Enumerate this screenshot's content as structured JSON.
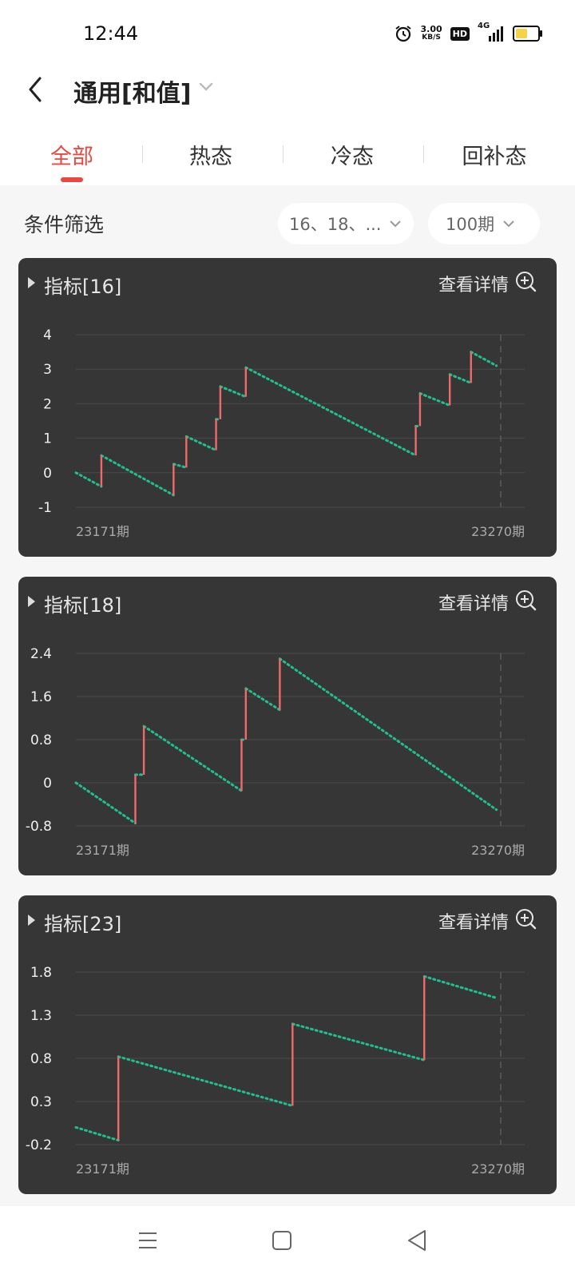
{
  "status": {
    "time": "12:44",
    "speed_value": "3.00",
    "speed_unit": "KB/S",
    "hd": "HD",
    "network": "4G"
  },
  "header": {
    "title": "通用[和值]"
  },
  "tabs": [
    {
      "label": "全部"
    },
    {
      "label": "热态"
    },
    {
      "label": "冷态"
    },
    {
      "label": "回补态"
    }
  ],
  "filter": {
    "label": "条件筛选",
    "conditions": "16、18、...",
    "period": "100期"
  },
  "detail_label": "查看详情",
  "colors": {
    "accent": "#e8483f",
    "up_bar": "#ef6a6a",
    "down_dots": "#1fbf8f",
    "card_bg": "#363636"
  },
  "chart_data": [
    {
      "type": "line",
      "title": "指标[16]",
      "x_start_label": "23171期",
      "x_end_label": "23270期",
      "yticks": [
        4,
        3,
        2,
        1,
        0,
        -1
      ],
      "ylim": [
        -1,
        4
      ],
      "xlim": [
        0,
        100
      ],
      "segments": [
        {
          "x0": 0,
          "y0": 0,
          "x1": 6,
          "y1": -0.4
        },
        {
          "x0": 6,
          "y0": 0.5,
          "x1": 23,
          "y1": -0.65
        },
        {
          "x0": 23,
          "y0": 0.25,
          "x1": 26,
          "y1": 0.15
        },
        {
          "x0": 26,
          "y0": 1.05,
          "x1": 33,
          "y1": 0.65
        },
        {
          "x0": 33,
          "y0": 1.55,
          "x1": 34,
          "y1": 1.55
        },
        {
          "x0": 34,
          "y0": 2.5,
          "x1": 40,
          "y1": 2.2
        },
        {
          "x0": 40,
          "y0": 3.05,
          "x1": 80,
          "y1": 0.5
        },
        {
          "x0": 80,
          "y0": 1.35,
          "x1": 81,
          "y1": 1.35
        },
        {
          "x0": 81,
          "y0": 2.3,
          "x1": 88,
          "y1": 1.95
        },
        {
          "x0": 88,
          "y0": 2.85,
          "x1": 93,
          "y1": 2.6
        },
        {
          "x0": 93,
          "y0": 3.5,
          "x1": 99,
          "y1": 3.1
        }
      ],
      "jumps": [
        {
          "x": 6,
          "from": -0.4,
          "to": 0.5
        },
        {
          "x": 23,
          "from": -0.65,
          "to": 0.25
        },
        {
          "x": 26,
          "from": 0.15,
          "to": 1.05
        },
        {
          "x": 33,
          "from": 0.65,
          "to": 1.55
        },
        {
          "x": 34,
          "from": 1.55,
          "to": 2.5
        },
        {
          "x": 40,
          "from": 2.2,
          "to": 3.05
        },
        {
          "x": 80,
          "from": 0.5,
          "to": 1.35
        },
        {
          "x": 81,
          "from": 1.35,
          "to": 2.3
        },
        {
          "x": 88,
          "from": 1.95,
          "to": 2.85
        },
        {
          "x": 93,
          "from": 2.6,
          "to": 3.5
        }
      ]
    },
    {
      "type": "line",
      "title": "指标[18]",
      "x_start_label": "23171期",
      "x_end_label": "23270期",
      "yticks": [
        2.4,
        1.6,
        0.8,
        0,
        -0.8
      ],
      "ylim": [
        -0.8,
        2.4
      ],
      "xlim": [
        0,
        100
      ],
      "segments": [
        {
          "x0": 0,
          "y0": 0,
          "x1": 14,
          "y1": -0.75
        },
        {
          "x0": 14,
          "y0": 0.15,
          "x1": 16,
          "y1": 0.15
        },
        {
          "x0": 16,
          "y0": 1.05,
          "x1": 39,
          "y1": -0.15
        },
        {
          "x0": 39,
          "y0": 0.8,
          "x1": 40,
          "y1": 0.8
        },
        {
          "x0": 40,
          "y0": 1.75,
          "x1": 48,
          "y1": 1.35
        },
        {
          "x0": 48,
          "y0": 2.3,
          "x1": 99,
          "y1": -0.5
        }
      ],
      "jumps": [
        {
          "x": 14,
          "from": -0.75,
          "to": 0.15
        },
        {
          "x": 16,
          "from": 0.15,
          "to": 1.05
        },
        {
          "x": 39,
          "from": -0.15,
          "to": 0.8
        },
        {
          "x": 40,
          "from": 0.8,
          "to": 1.75
        },
        {
          "x": 48,
          "from": 1.35,
          "to": 2.3
        }
      ]
    },
    {
      "type": "line",
      "title": "指标[23]",
      "x_start_label": "23171期",
      "x_end_label": "23270期",
      "yticks": [
        1.8,
        1.3,
        0.8,
        0.3,
        -0.2
      ],
      "ylim": [
        -0.2,
        1.8
      ],
      "xlim": [
        0,
        100
      ],
      "segments": [
        {
          "x0": 0,
          "y0": 0,
          "x1": 10,
          "y1": -0.15
        },
        {
          "x0": 10,
          "y0": 0.82,
          "x1": 51,
          "y1": 0.25
        },
        {
          "x0": 51,
          "y0": 1.2,
          "x1": 82,
          "y1": 0.78
        },
        {
          "x0": 82,
          "y0": 1.75,
          "x1": 99,
          "y1": 1.5
        }
      ],
      "jumps": [
        {
          "x": 10,
          "from": -0.15,
          "to": 0.82
        },
        {
          "x": 51,
          "from": 0.25,
          "to": 1.2
        },
        {
          "x": 82,
          "from": 0.78,
          "to": 1.75
        }
      ]
    }
  ]
}
